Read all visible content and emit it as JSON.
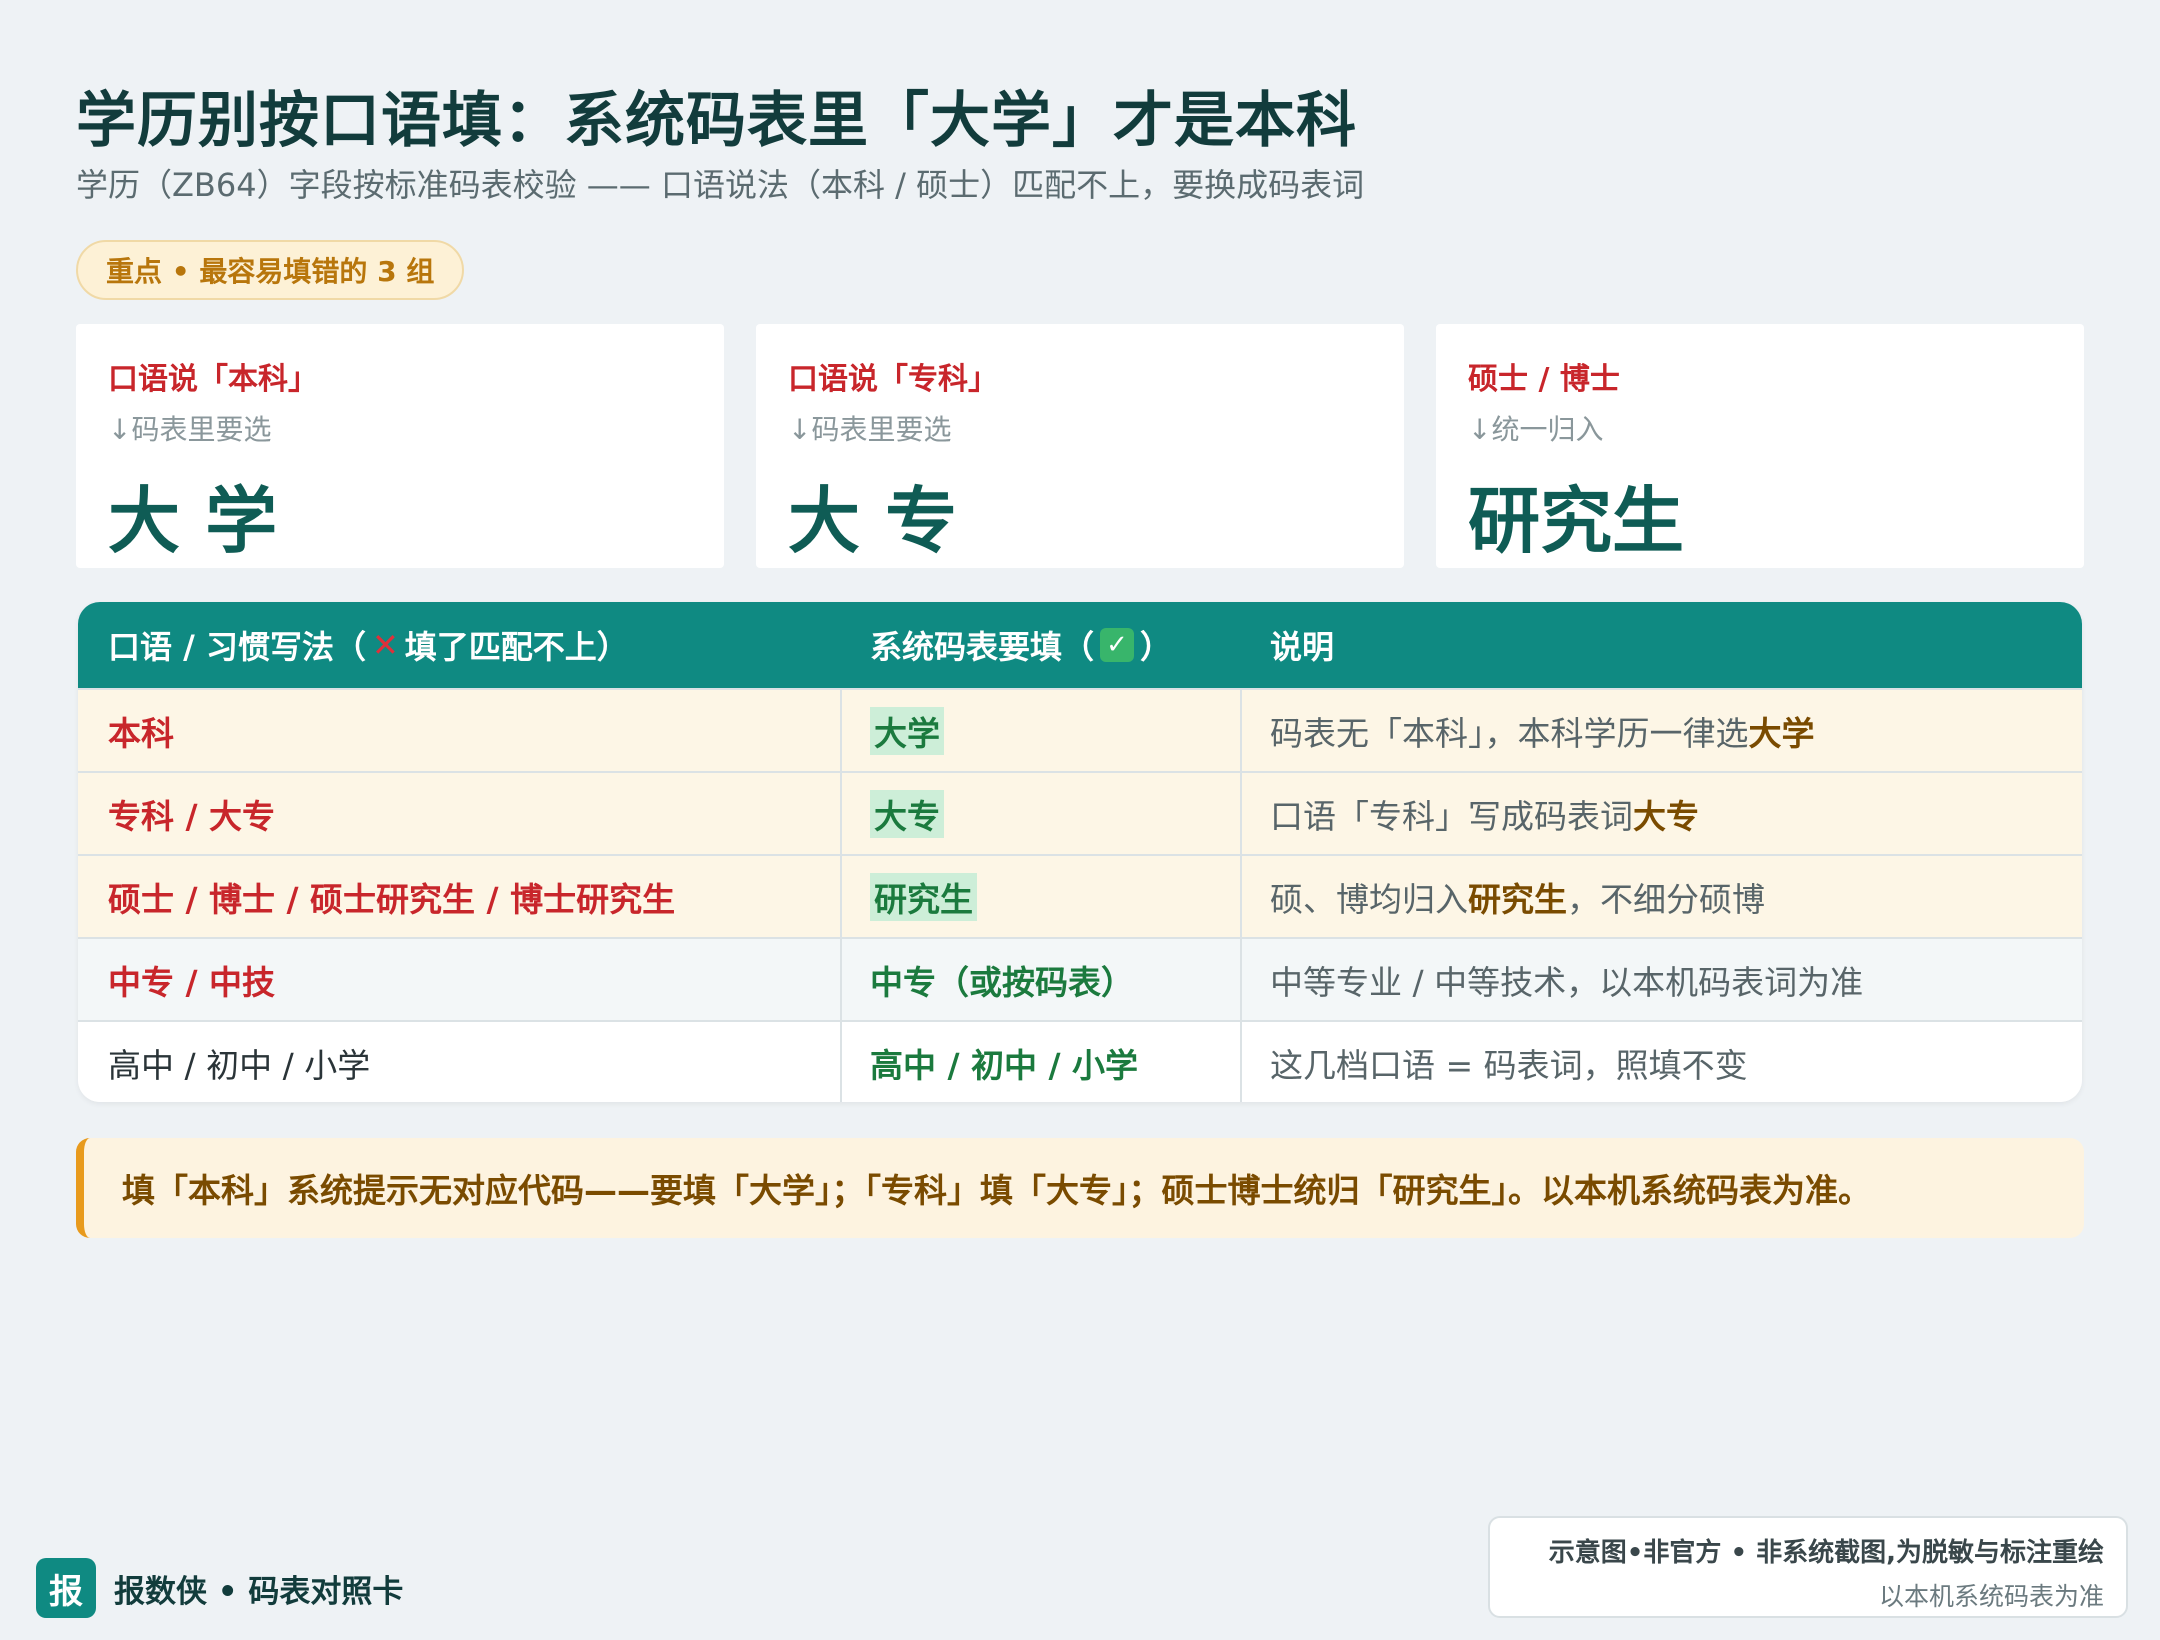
{
  "header": {
    "title": "学历别按口语填：系统码表里「大学」才是本科",
    "subtitle": "学历（ZB64）字段按标准码表校验 —— 口语说法（本科 / 硕士）匹配不上，要换成码表词",
    "badge": "重点 • 最容易填错的 3 组"
  },
  "cards": [
    {
      "head": "口语说「本科」",
      "arrow": "↓码表里要选",
      "value": "大 学"
    },
    {
      "head": "口语说「专科」",
      "arrow": "↓码表里要选",
      "value": "大 专"
    },
    {
      "head": "硕士 / 博士",
      "arrow": "↓统一归入",
      "value": "研究生"
    }
  ],
  "table": {
    "headers": {
      "col1_prefix": "口语 / 习惯写法（",
      "col1_suffix": " 填了匹配不上）",
      "col2_prefix": "系统码表要填（",
      "col2_suffix": "）",
      "col3": "说明"
    },
    "rows": [
      {
        "spoken": "本科",
        "code": "大学",
        "note_a": "码表无「本科」，本科学历一律选",
        "note_b": "大学",
        "note_c": ""
      },
      {
        "spoken": "专科 / 大专",
        "code": "大专",
        "note_a": "口语「专科」写成码表词",
        "note_b": "大专",
        "note_c": ""
      },
      {
        "spoken": "硕士 / 博士 / 硕士研究生 / 博士研究生",
        "code": "研究生",
        "note_a": "硕、博均归入",
        "note_b": "研究生",
        "note_c": "，不细分硕博"
      },
      {
        "spoken": "中专 / 中技",
        "code": "中专（或按码表）",
        "note": "中等专业 / 中等技术，以本机码表词为准"
      },
      {
        "spoken": "高中 / 初中 / 小学",
        "code": "高中 / 初中 / 小学",
        "note": "这几档口语 = 码表词，照填不变"
      }
    ]
  },
  "note": "填「本科」系统提示无对应代码——要填「大学」；「专科」填「大专」；硕士博士统归「研究生」。以本机系统码表为准。",
  "footer": {
    "logo": "报",
    "brand": "报数侠 • 码表对照卡",
    "disclaimer_1": "示意图•非官方 • 非系统截图,为脱敏与标注重绘",
    "disclaimer_2": "以本机系统码表为准"
  },
  "icons": {
    "wrong": "cross-mark-icon",
    "right": "check-mark-icon"
  },
  "colors": {
    "accent": "#0f8a82",
    "highlight_rows": "#fdf6e6",
    "error_text": "#c8262b",
    "ok_text": "#1b7a3e"
  }
}
